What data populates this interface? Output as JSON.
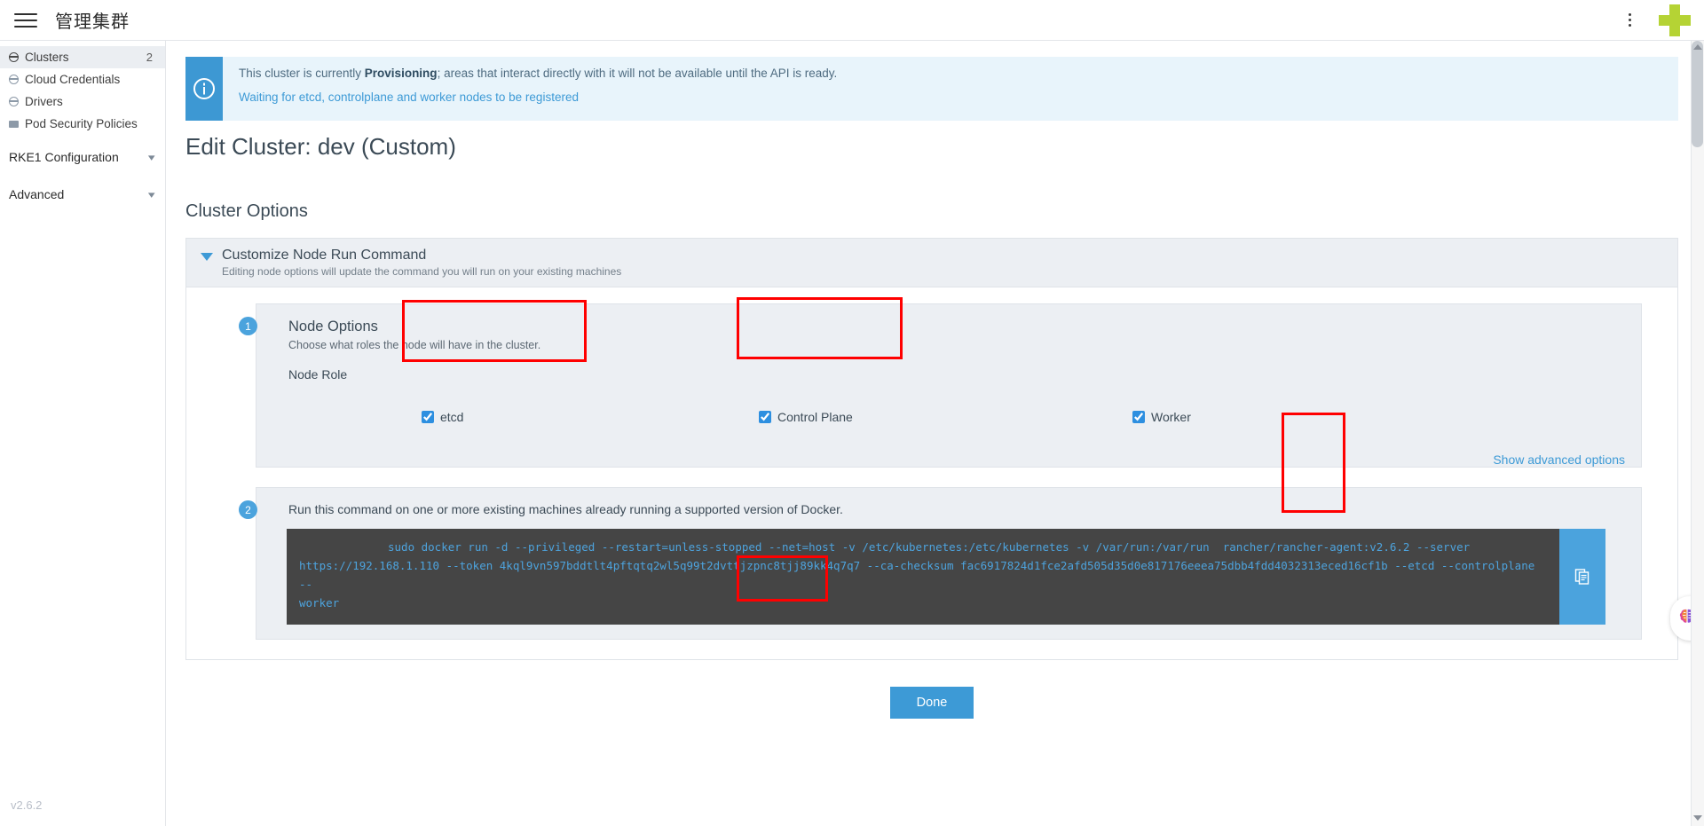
{
  "topbar": {
    "title": "管理集群",
    "menu_icon": "hamburger-icon",
    "kebab_icon": "kebab-menu-icon",
    "logo_icon": "rancher-logo-icon"
  },
  "sidebar": {
    "items": [
      {
        "label": "Clusters",
        "count": "2",
        "icon": "globe-icon",
        "active": true
      },
      {
        "label": "Cloud Credentials",
        "count": "",
        "icon": "globe-icon",
        "active": false
      },
      {
        "label": "Drivers",
        "count": "",
        "icon": "globe-icon",
        "active": false
      },
      {
        "label": "Pod Security Policies",
        "count": "",
        "icon": "folder-icon",
        "active": false
      }
    ],
    "groups": [
      {
        "label": "RKE1 Configuration",
        "icon": "chevron-down-icon"
      },
      {
        "label": "Advanced",
        "icon": "chevron-down-icon"
      }
    ],
    "version": "v2.6.2"
  },
  "banner": {
    "icon": "info-circle-icon",
    "text_before": "This cluster is currently ",
    "status": "Provisioning",
    "text_after": "; areas that interact directly with it will not be available until the API is ready.",
    "link": "Waiting for etcd, controlplane and worker nodes to be registered"
  },
  "page": {
    "title": "Edit Cluster: dev (Custom)",
    "section_title": "Cluster Options"
  },
  "panel": {
    "heading": "Customize Node Run Command",
    "subheading": "Editing node options will update the command you will run on your existing machines",
    "toggle_icon": "triangle-down-icon"
  },
  "step1": {
    "badge": "1",
    "heading": "Node Options",
    "subheading": "Choose what roles the node will have in the cluster.",
    "node_role_label": "Node Role",
    "roles": [
      {
        "label": "etcd",
        "checked": true
      },
      {
        "label": "Control Plane",
        "checked": true
      },
      {
        "label": "Worker",
        "checked": true
      }
    ],
    "advanced_link": "Show advanced options"
  },
  "step2": {
    "badge": "2",
    "text": "Run this command on one or more existing machines already running a supported version of Docker.",
    "command_line1": "sudo docker run -d --privileged --restart=unless-stopped --net=host -v /etc/kubernetes:/etc/kubernetes -v /var/run:/var/run  rancher/rancher-agent:v2.6.2 --server",
    "command_line2": "https://192.168.1.110 --token 4kql9vn597bddtlt4pftqtq2wl5q99t2dvttjzpnc8tjj89kk4q7q7 --ca-checksum fac6917824d1fce2afd505d35d0e817176eeea75dbb4fdd4032313eced16cf1b --etcd --controlplane --",
    "command_line3": "worker",
    "copy_icon": "clipboard-copy-icon"
  },
  "footer": {
    "done_label": "Done"
  },
  "widgets": {
    "ai_icon": "brain-icon"
  },
  "colors": {
    "accent": "#3d9ad6",
    "brand": "#b5d334",
    "annotation": "#ff0000",
    "terminal_bg": "#454545",
    "terminal_fg": "#4da3dd"
  }
}
